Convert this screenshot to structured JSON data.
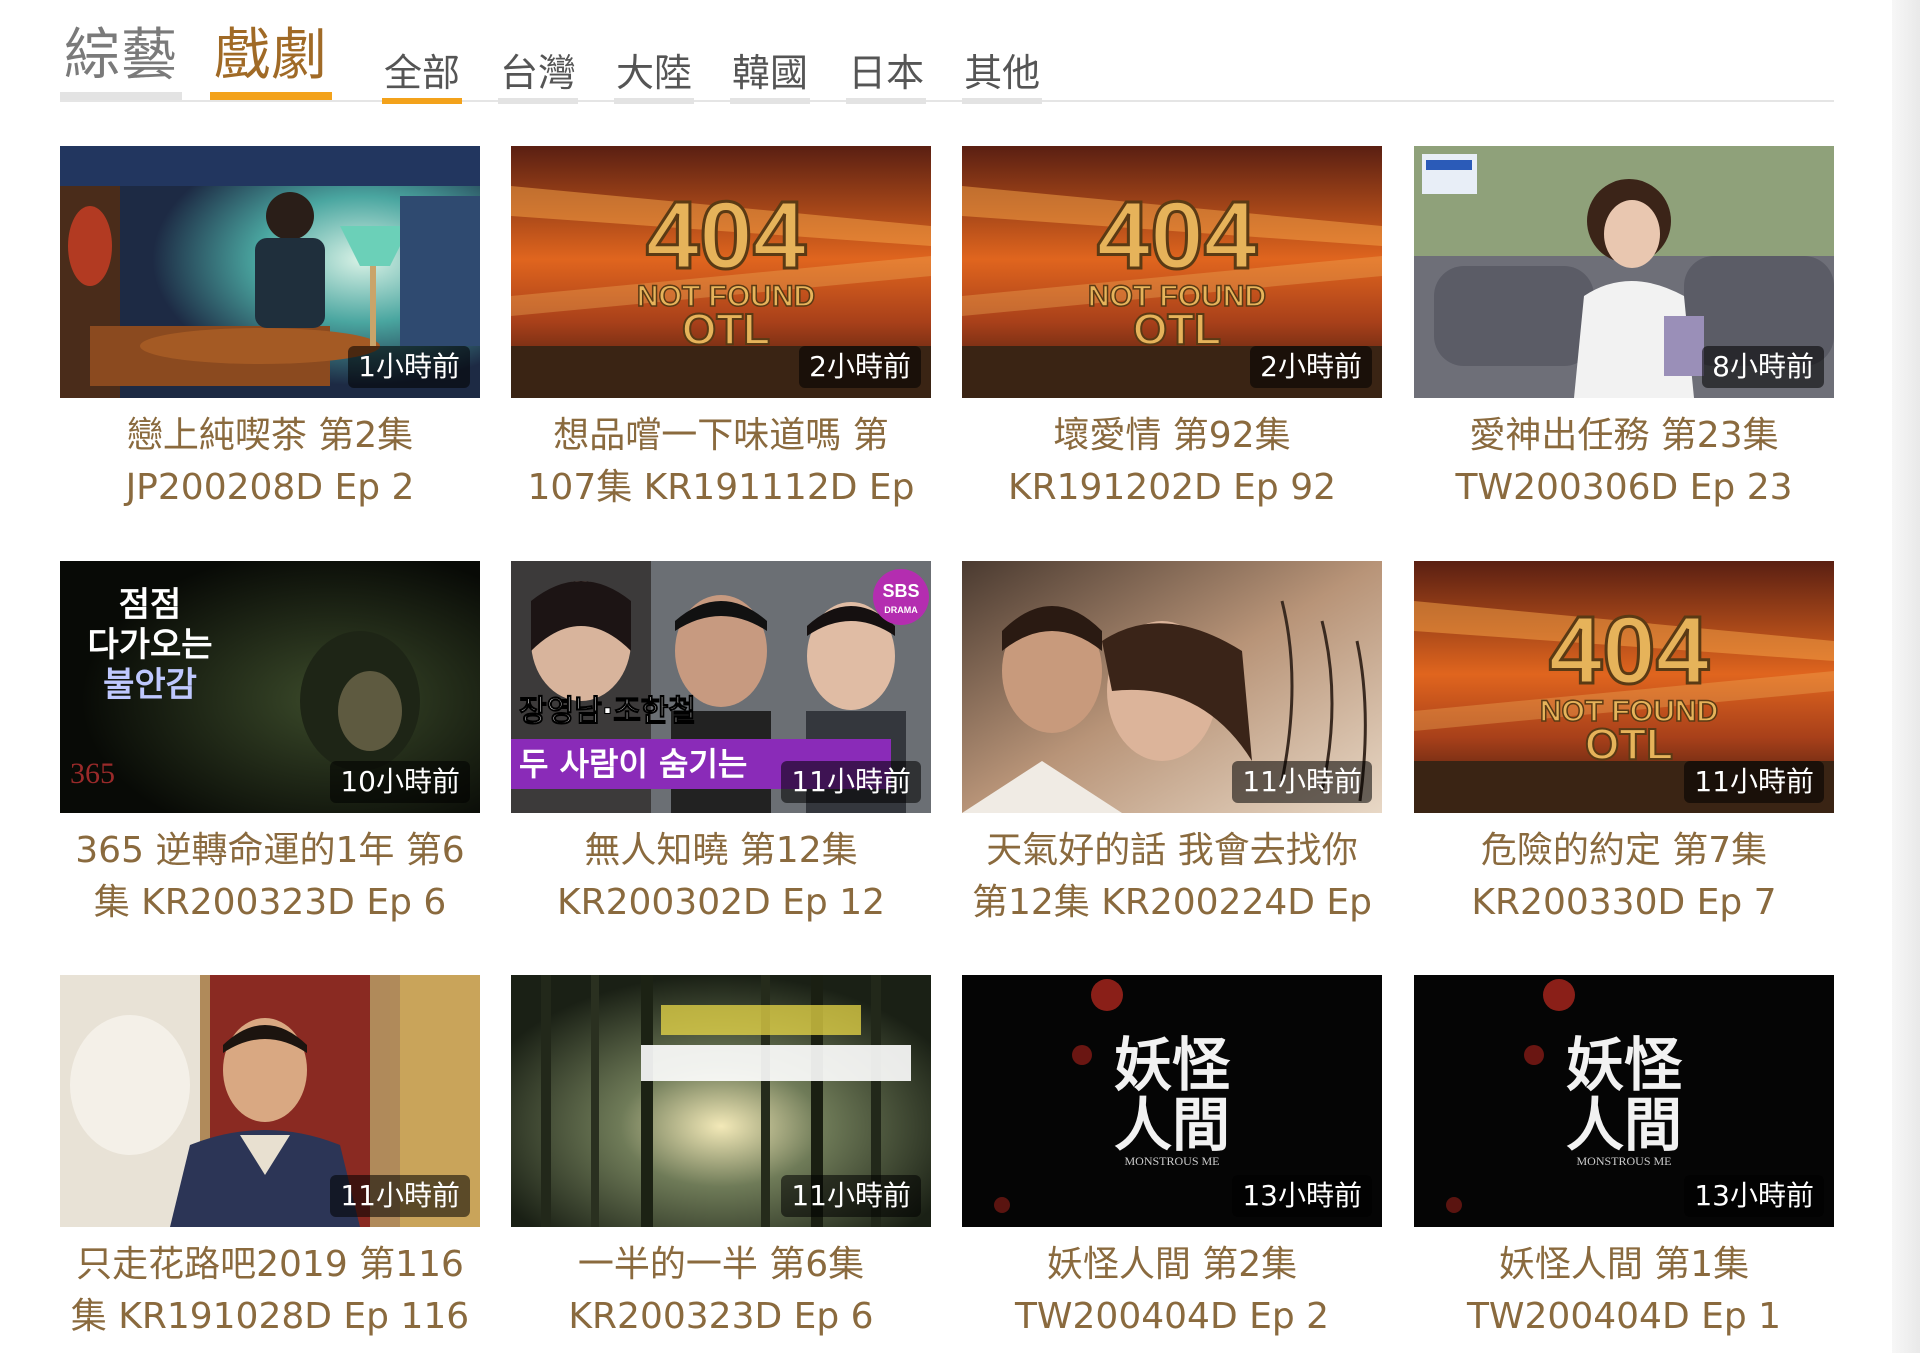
{
  "header": {
    "main_tabs": [
      {
        "label": "綜藝",
        "active": false
      },
      {
        "label": "戲劇",
        "active": true
      }
    ],
    "sub_tabs": [
      {
        "label": "全部",
        "active": true
      },
      {
        "label": "台灣",
        "active": false
      },
      {
        "label": "大陸",
        "active": false
      },
      {
        "label": "韓國",
        "active": false
      },
      {
        "label": "日本",
        "active": false
      },
      {
        "label": "其他",
        "active": false
      }
    ]
  },
  "colors": {
    "accent": "#f3a21b",
    "title_text": "#8a6a3e",
    "badge_bg": "rgba(0,0,0,0.55)"
  },
  "videos": [
    {
      "time": "1小時前",
      "line1": "戀上純喫茶 第2集",
      "line2": "JP200208D Ep 2",
      "thumb": "cafe-scene"
    },
    {
      "time": "2小時前",
      "line1": "想品嚐一下味道嗎 第",
      "line2": "107集 KR191112D Ep",
      "thumb": "not-found-404",
      "thumb_text": {
        "big": "404",
        "mid": "NOT FOUND",
        "small": "OTL"
      }
    },
    {
      "time": "2小時前",
      "line1": "壞愛情 第92集",
      "line2": "KR191202D Ep 92",
      "thumb": "not-found-404",
      "thumb_text": {
        "big": "404",
        "mid": "NOT FOUND",
        "small": "OTL"
      }
    },
    {
      "time": "8小時前",
      "line1": "愛神出任務 第23集",
      "line2": "TW200306D Ep 23",
      "thumb": "sofa-scene"
    },
    {
      "time": "10小時前",
      "line1": "365 逆轉命運的1年 第6",
      "line2": "集 KR200323D Ep 6",
      "thumb": "dark-korean",
      "thumb_text": {
        "l1": "점점",
        "l2": "다가오는",
        "l3": "불안감",
        "corner": "365"
      }
    },
    {
      "time": "11小時前",
      "line1": "無人知曉 第12集",
      "line2": "KR200302D Ep 12",
      "thumb": "sbs-drama",
      "thumb_text": {
        "logo": "SBS",
        "logo_sub": "DRAMA",
        "caption1": "장영남·조한철",
        "caption2": "두 사람이 숨기는"
      }
    },
    {
      "time": "11小時前",
      "line1": "天氣好的話 我會去找你",
      "line2": "第12集 KR200224D Ep",
      "thumb": "romance-scene"
    },
    {
      "time": "11小時前",
      "line1": "危險的約定 第7集",
      "line2": "KR200330D Ep 7",
      "thumb": "not-found-404",
      "thumb_text": {
        "big": "404",
        "mid": "NOT FOUND",
        "small": "OTL"
      }
    },
    {
      "time": "11小時前",
      "line1": "只走花路吧2019 第116",
      "line2": "集 KR191028D Ep 116",
      "thumb": "man-smiling"
    },
    {
      "time": "11小時前",
      "line1": "一半的一半 第6集",
      "line2": "KR200323D Ep 6",
      "thumb": "forest-scene"
    },
    {
      "time": "13小時前",
      "line1": "妖怪人間 第2集",
      "line2": "TW200404D Ep 2",
      "thumb": "monstrous-title",
      "thumb_text": {
        "title1": "妖怪",
        "title2": "人間",
        "sub": "MONSTROUS ME"
      }
    },
    {
      "time": "13小時前",
      "line1": "妖怪人間 第1集",
      "line2": "TW200404D Ep 1",
      "thumb": "monstrous-title",
      "thumb_text": {
        "title1": "妖怪",
        "title2": "人間",
        "sub": "MONSTROUS ME"
      }
    }
  ]
}
